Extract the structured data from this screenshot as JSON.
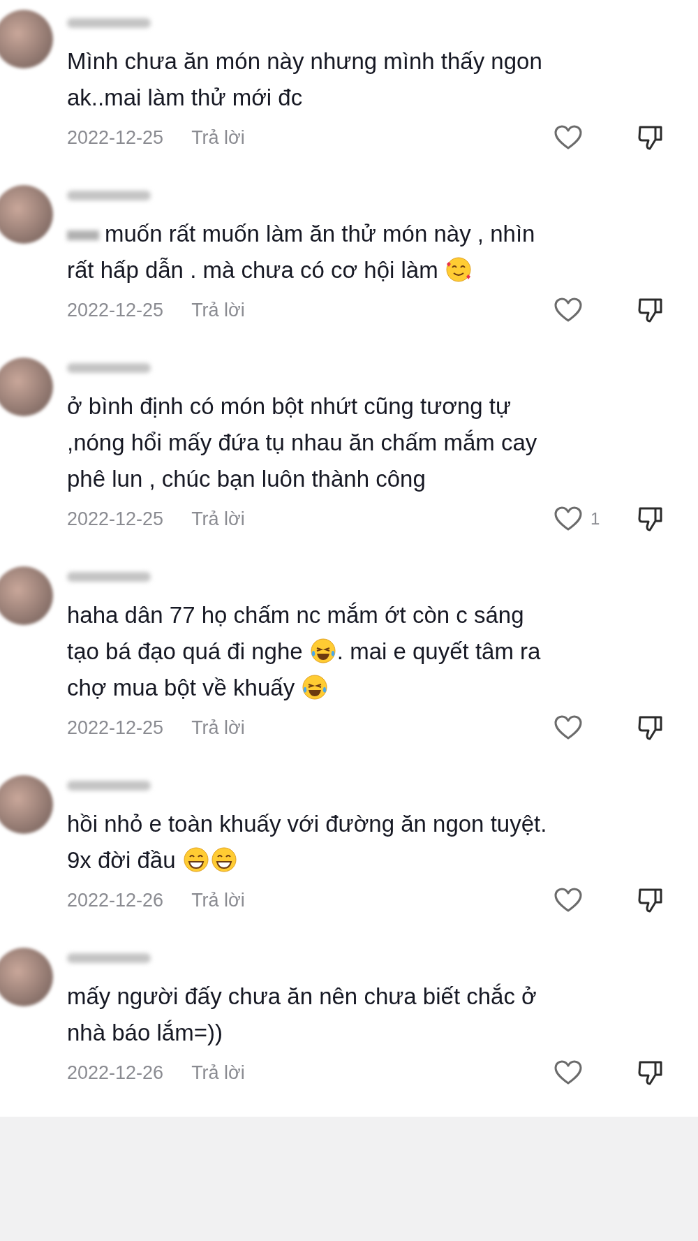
{
  "comments": [
    {
      "parts": [
        {
          "kind": "text",
          "text": "Mình chưa ăn món này nhưng mình thấy ngon ak..mai làm thử mới đc"
        }
      ],
      "date": "2022-12-25",
      "reply": "Trả lời",
      "liked": false
    },
    {
      "name_blurred_prefix": true,
      "parts": [
        {
          "kind": "text",
          "text": "muốn rất muốn làm ăn thử món này , nhìn rất hấp dẫn . mà chưa có cơ hội làm "
        },
        {
          "kind": "hearts-emoji"
        }
      ],
      "date": "2022-12-25",
      "reply": "Trả lời",
      "liked": false
    },
    {
      "parts": [
        {
          "kind": "text",
          "text": "ở bình định có món bột nhứt cũng tương tự ,nóng hổi mấy đứa tụ nhau ăn chấm mắm cay phê lun , chúc bạn luôn thành công"
        }
      ],
      "date": "2022-12-25",
      "reply": "Trả lời",
      "liked": false,
      "like_count": "1"
    },
    {
      "parts": [
        {
          "kind": "text",
          "text": "haha dân 77 họ chấm nc mắm ớt còn c sáng tạo bá đạo quá đi nghe "
        },
        {
          "kind": "laugh-emoji"
        },
        {
          "kind": "text",
          "text": ". mai e quyết tâm ra chợ mua bột về khuấy "
        },
        {
          "kind": "laugh-emoji"
        }
      ],
      "date": "2022-12-25",
      "reply": "Trả lời",
      "liked": false
    },
    {
      "parts": [
        {
          "kind": "text",
          "text": "hồi nhỏ e toàn khuấy với đường ăn ngon tuyệt. 9x đời đầu "
        },
        {
          "kind": "grin-emoji"
        },
        {
          "kind": "grin-emoji"
        }
      ],
      "date": "2022-12-26",
      "reply": "Trả lời",
      "liked": false
    },
    {
      "parts": [
        {
          "kind": "text",
          "text": "mấy người đấy chưa ăn nên chưa biết chắc ở nhà báo lắm=))"
        }
      ],
      "date": "2022-12-26",
      "reply": "Trả lời",
      "liked": false
    }
  ]
}
